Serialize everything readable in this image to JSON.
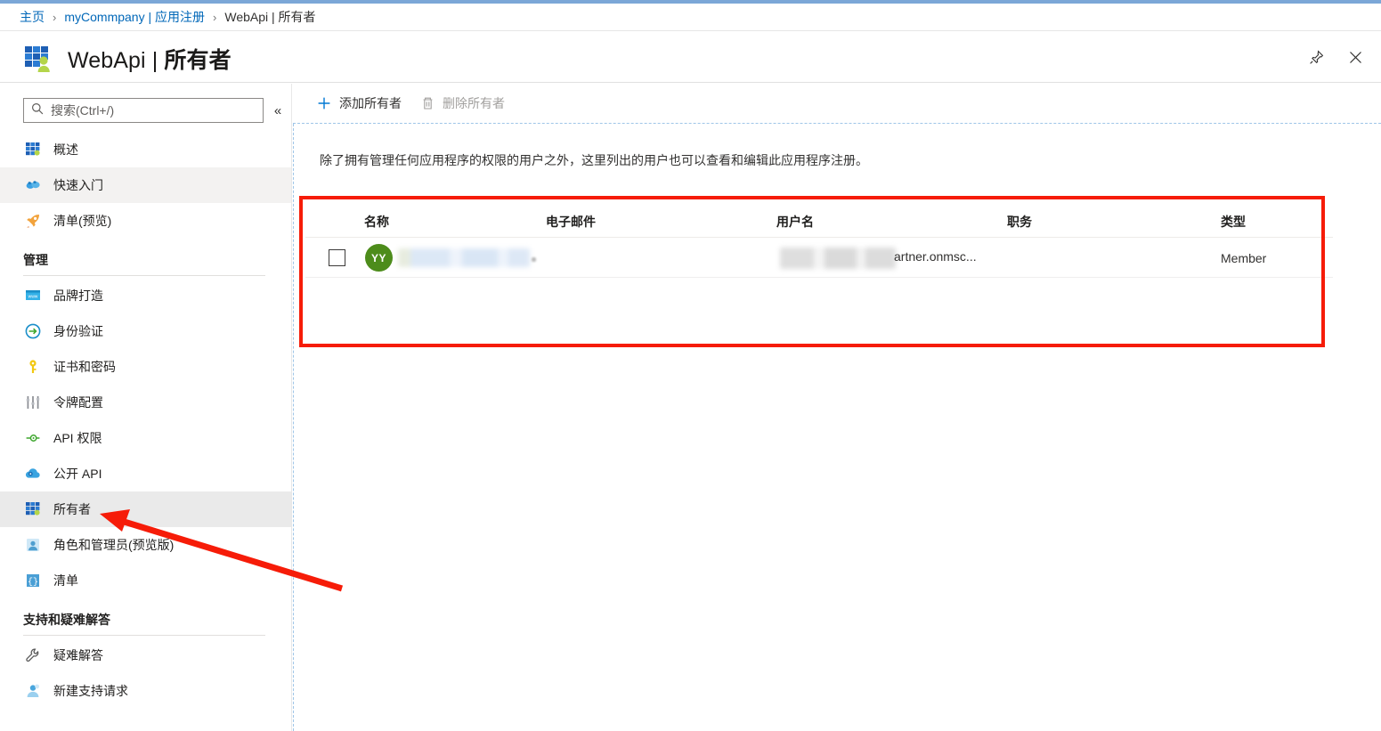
{
  "breadcrumb": {
    "home": "主页",
    "tenant": "myCommpany | 应用注册",
    "current": "WebApi | 所有者",
    "separator": "›"
  },
  "header": {
    "title_main": "WebApi | ",
    "title_bold": "所有者",
    "icon": "app-registration-owners-icon",
    "pin_icon": "pin-icon",
    "close_icon": "close-icon"
  },
  "sidebar": {
    "search": {
      "placeholder": "搜索(Ctrl+/)",
      "value": "",
      "icon": "search-icon"
    },
    "collapse_icon": "«",
    "items": [
      {
        "label": "概述",
        "icon": "overview-grid-icon",
        "selected": false
      },
      {
        "label": "快速入门",
        "icon": "quickstart-cloud-icon",
        "selected": false,
        "hover": true
      },
      {
        "label": "清单(预览)",
        "icon": "rocket-icon",
        "selected": false
      }
    ],
    "groups": [
      {
        "title": "管理",
        "items": [
          {
            "label": "品牌打造",
            "icon": "branding-icon",
            "selected": false
          },
          {
            "label": "身份验证",
            "icon": "authentication-icon",
            "selected": false
          },
          {
            "label": "证书和密码",
            "icon": "key-icon",
            "selected": false
          },
          {
            "label": "令牌配置",
            "icon": "token-sliders-icon",
            "selected": false
          },
          {
            "label": "API 权限",
            "icon": "api-permissions-icon",
            "selected": false
          },
          {
            "label": "公开 API",
            "icon": "expose-api-cloud-icon",
            "selected": false
          },
          {
            "label": "所有者",
            "icon": "owners-icon",
            "selected": true
          },
          {
            "label": "角色和管理员(预览版)",
            "icon": "roles-admins-icon",
            "selected": false
          },
          {
            "label": "清单",
            "icon": "manifest-icon",
            "selected": false
          }
        ]
      },
      {
        "title": "支持和疑难解答",
        "items": [
          {
            "label": "疑难解答",
            "icon": "wrench-icon",
            "selected": false
          },
          {
            "label": "新建支持请求",
            "icon": "support-person-icon",
            "selected": false
          }
        ]
      }
    ]
  },
  "toolbar": {
    "add_label": "添加所有者",
    "add_icon": "plus-icon",
    "delete_label": "删除所有者",
    "delete_icon": "trash-icon"
  },
  "main": {
    "description": "除了拥有管理任何应用程序的权限的用户之外，这里列出的用户也可以查看和编辑此应用程序注册。"
  },
  "table": {
    "columns": [
      "名称",
      "电子邮件",
      "用户名",
      "职务",
      "类型"
    ],
    "rows": [
      {
        "checked": false,
        "avatar_initials": "YY",
        "avatar_color": "#4d8c1b",
        "name": "",
        "email": "",
        "username_suffix": "artner.onmsc...",
        "job_title": "",
        "type": "Member"
      }
    ]
  },
  "annotations": {
    "highlight_color": "#f61c08",
    "arrow_target": "所有者"
  }
}
